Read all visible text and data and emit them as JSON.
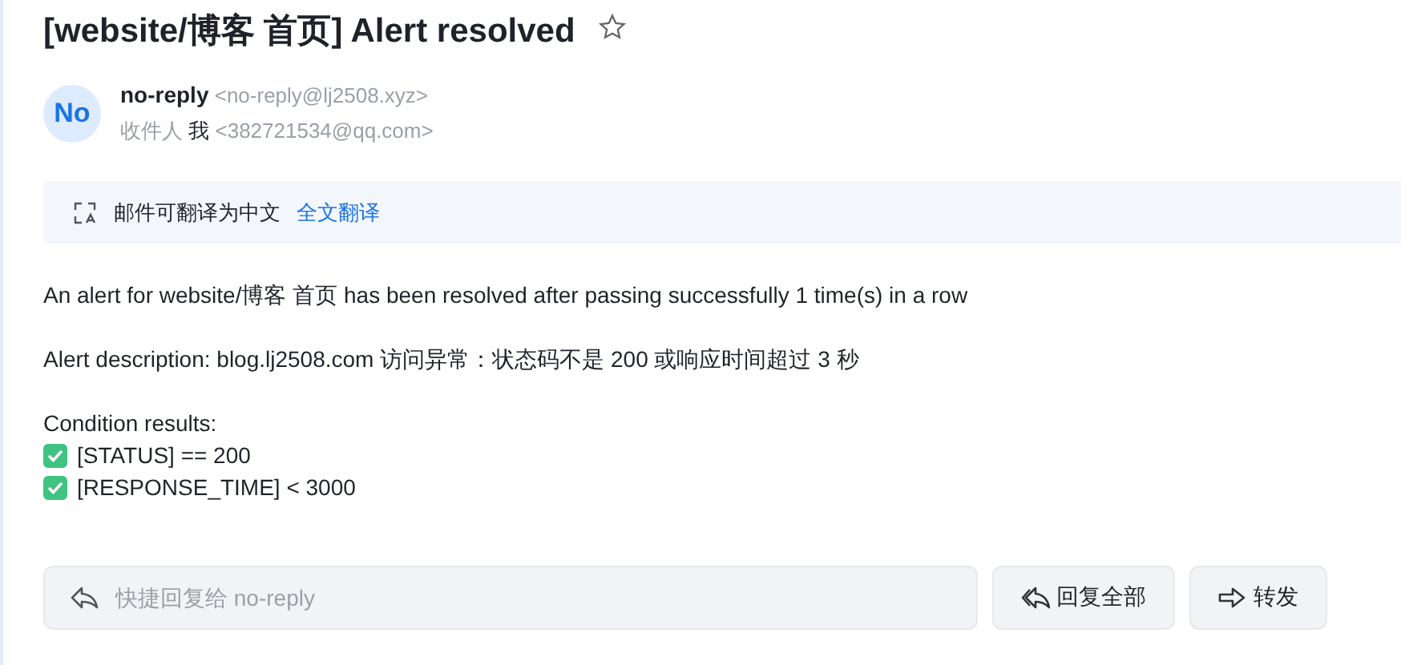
{
  "subject": "[website/博客 首页] Alert resolved",
  "starred": false,
  "sender": {
    "avatar": "No",
    "name": "no-reply",
    "address": "<no-reply@lj2508.xyz>"
  },
  "recipient": {
    "label": "收件人",
    "name": "我",
    "address": "<382721534@qq.com>"
  },
  "translate": {
    "message": "邮件可翻译为中文",
    "link": "全文翻译"
  },
  "body": {
    "paragraphs": [
      "An alert for website/博客 首页 has been resolved after passing successfully 1 time(s) in a row",
      "Alert description: blog.lj2508.com 访问异常：状态码不是 200 或响应时间超过 3 秒"
    ],
    "conditions_title": "Condition results:",
    "conditions": [
      {
        "text": "[STATUS] == 200",
        "checked": true
      },
      {
        "text": "[RESPONSE_TIME] < 3000",
        "checked": true
      }
    ]
  },
  "quick_reply": {
    "placeholder": "快捷回复给 no-reply"
  },
  "buttons": [
    {
      "kind": "reply-all",
      "label": "回复全部"
    },
    {
      "kind": "forward",
      "label": "转发"
    }
  ]
}
